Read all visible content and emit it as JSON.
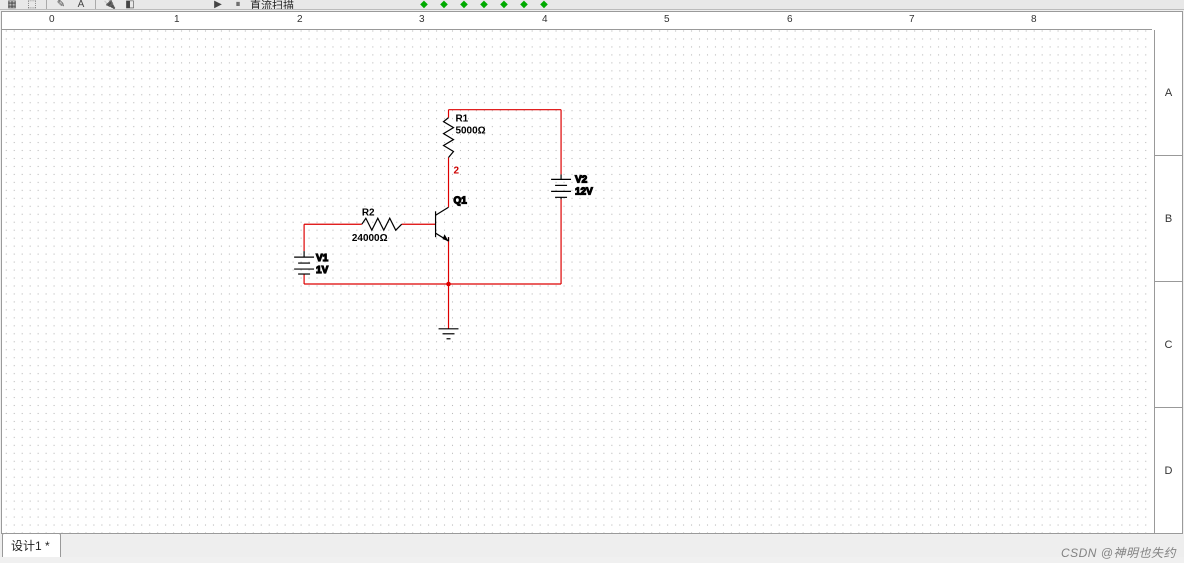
{
  "toolbar": {
    "mode_label": "直流扫描"
  },
  "ruler": {
    "ticks": [
      "0",
      "1",
      "2",
      "3",
      "4",
      "5",
      "6",
      "7",
      "8"
    ]
  },
  "zones": [
    "A",
    "B",
    "C",
    "D"
  ],
  "components": {
    "r1": {
      "name": "R1",
      "value": "5000Ω"
    },
    "r2": {
      "name": "R2",
      "value": "24000Ω"
    },
    "v1": {
      "name": "V1",
      "value": "1V"
    },
    "v2": {
      "name": "V2",
      "value": "12V"
    },
    "q1": {
      "name": "Q1"
    },
    "net2": "2"
  },
  "tab": {
    "label": "设计1 *"
  },
  "watermark": "CSDN @神明也失约"
}
